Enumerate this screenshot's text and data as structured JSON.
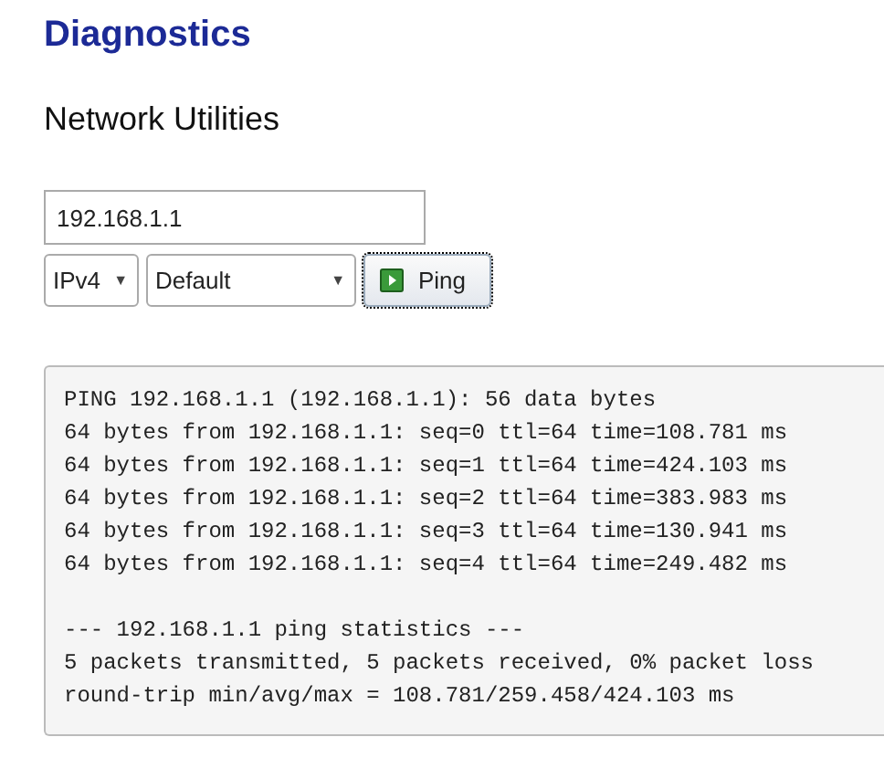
{
  "page": {
    "title": "Diagnostics",
    "section": "Network Utilities"
  },
  "host_field": {
    "value": "192.168.1.1"
  },
  "protocol_select": {
    "value": "IPv4",
    "arrow": "▼"
  },
  "interface_select": {
    "value": "Default",
    "arrow": "▼"
  },
  "ping_button": {
    "label": "Ping"
  },
  "output": {
    "reply_lines": [
      "PING 192.168.1.1 (192.168.1.1): 56 data bytes",
      "64 bytes from 192.168.1.1: seq=0 ttl=64 time=108.781 ms",
      "64 bytes from 192.168.1.1: seq=1 ttl=64 time=424.103 ms",
      "64 bytes from 192.168.1.1: seq=2 ttl=64 time=383.983 ms",
      "64 bytes from 192.168.1.1: seq=3 ttl=64 time=130.941 ms",
      "64 bytes from 192.168.1.1: seq=4 ttl=64 time=249.482 ms"
    ],
    "summary_lines": [
      "--- 192.168.1.1 ping statistics ---",
      "5 packets transmitted, 5 packets received, 0% packet loss",
      "round-trip min/avg/max = 108.781/259.458/424.103 ms"
    ]
  }
}
